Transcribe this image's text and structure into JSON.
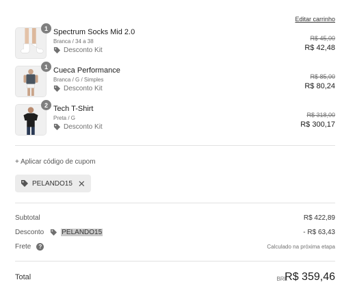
{
  "cart": {
    "edit_label": "Editar carrinho",
    "items": [
      {
        "quantity": "1",
        "name": "Spectrum Socks Mid 2.0",
        "variant": "Branca / 34 a 38",
        "discount_label": "Desconto Kit",
        "old_price": "R$ 45,00",
        "new_price": "R$ 42,48"
      },
      {
        "quantity": "1",
        "name": "Cueca Performance",
        "variant": "Branca / G / Simples",
        "discount_label": "Desconto Kit",
        "old_price": "R$ 85,00",
        "new_price": "R$ 80,24"
      },
      {
        "quantity": "2",
        "name": "Tech T-Shirt",
        "variant": "Preta / G",
        "discount_label": "Desconto Kit",
        "old_price": "R$ 318,00",
        "new_price": "R$ 300,17"
      }
    ]
  },
  "coupon": {
    "apply_label": "+ Aplicar código de cupom",
    "applied_code": "PELANDO15"
  },
  "summary": {
    "subtotal_label": "Subtotal",
    "subtotal_value": "R$ 422,89",
    "discount_label": "Desconto",
    "discount_code": "PELANDO15",
    "discount_value": "- R$ 63,43",
    "shipping_label": "Frete",
    "shipping_value": "Calculado na próxima etapa",
    "total_label": "Total",
    "currency": "BRL",
    "total_value": "R$ 359,46"
  },
  "icons": {
    "tag": "tag-icon",
    "close": "close-icon",
    "help": "help-icon"
  },
  "colors": {
    "badge": "#7f7f7f",
    "chip_background": "#ececec",
    "code_highlight": "#c9c9c9"
  }
}
